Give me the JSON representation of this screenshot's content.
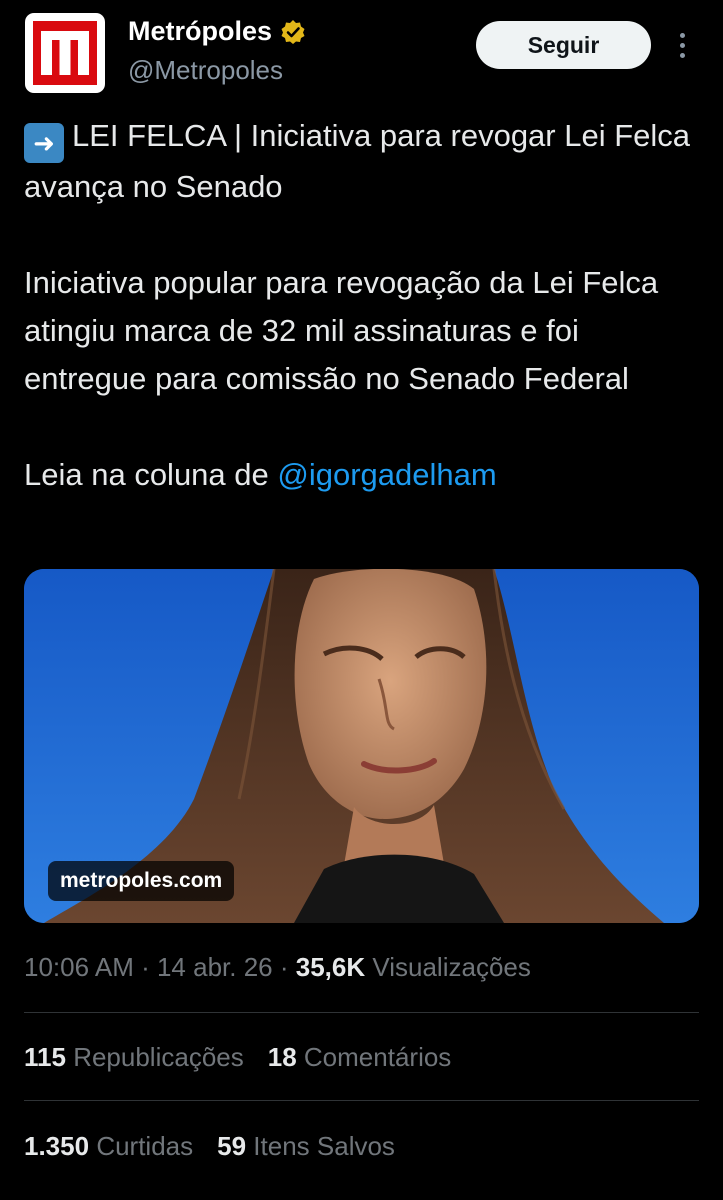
{
  "account": {
    "name": "Metrópoles",
    "handle": "@Metropoles",
    "follow_label": "Seguir"
  },
  "tweet": {
    "headline_prefix": "➡️",
    "headline": "LEI FELCA | Iniciativa para revogar Lei Felca avança no Senado",
    "body": "Iniciativa popular para revogação da Lei Felca atingiu marca de 32 mil assinaturas e foi entregue para comissão no Senado Federal",
    "read_prefix": "Leia na coluna de ",
    "mention": "@igorgadelham"
  },
  "media": {
    "domain": "metropoles.com"
  },
  "meta": {
    "time": "10:06 AM",
    "sep1": " · ",
    "date": "14 abr. 26",
    "sep2": " · ",
    "views_count": "35,6K",
    "views_label": "Visualizações"
  },
  "stats": {
    "reposts_count": "115",
    "reposts_label": "Republicações",
    "comments_count": "18",
    "comments_label": "Comentários",
    "likes_count": "1.350",
    "likes_label": "Curtidas",
    "saves_count": "59",
    "saves_label": "Itens Salvos"
  },
  "colors": {
    "background": "#000000",
    "brand_red": "#d90a0f",
    "link_blue": "#1d9bf0",
    "verified_gold": "#e2b719",
    "sky_blue": "#1a66cf"
  },
  "icons": {
    "verified": "verified-badge-icon",
    "more": "more-vertical-icon",
    "logo": "metropoles-logo-icon"
  }
}
